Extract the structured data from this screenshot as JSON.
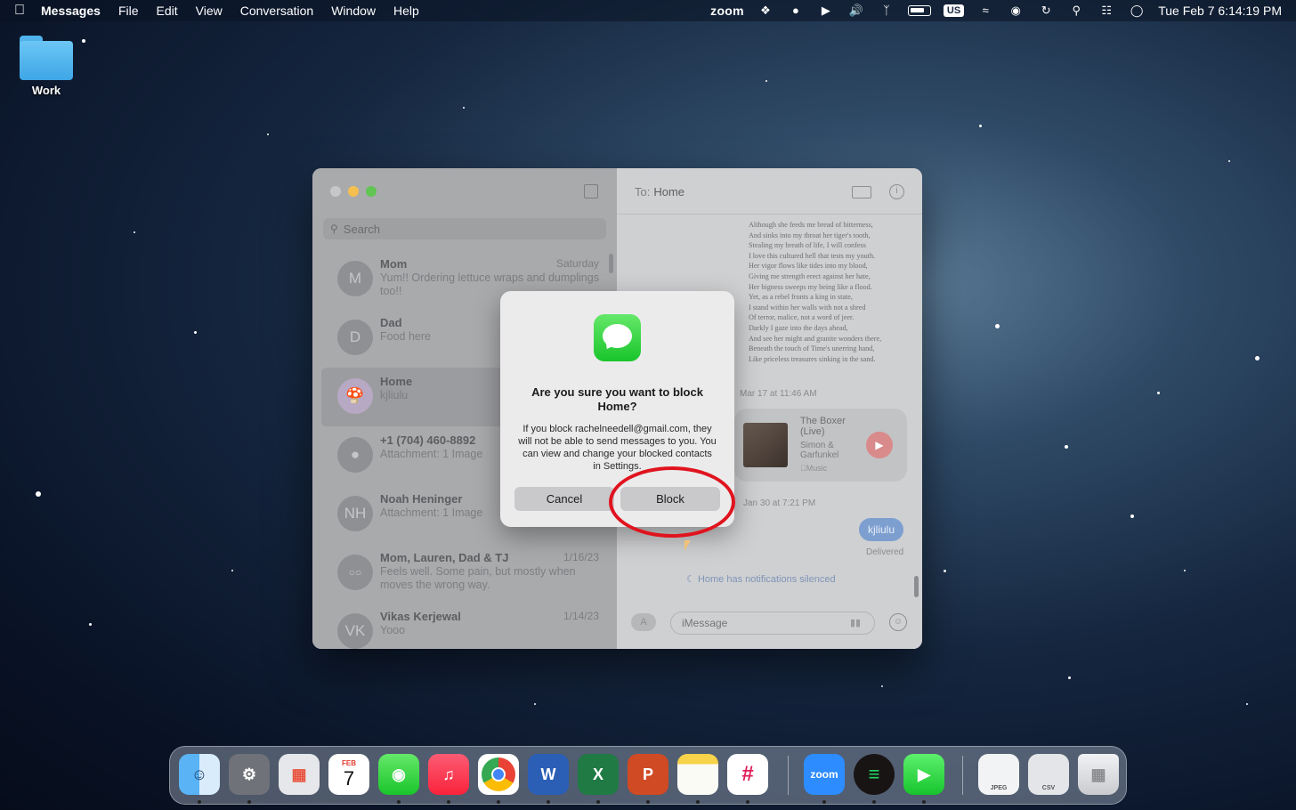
{
  "menubar": {
    "app_name": "Messages",
    "menus": [
      "File",
      "Edit",
      "View",
      "Conversation",
      "Window",
      "Help"
    ],
    "zoom_label": "zoom",
    "input_source": "US",
    "datetime": "Tue Feb 7  6:14:19 PM"
  },
  "desktop": {
    "folder_label": "Work"
  },
  "messages": {
    "search_placeholder": "Search",
    "conversations": [
      {
        "initials": "M",
        "name": "Mom",
        "preview": "Yum!! Ordering lettuce wraps and dumplings too!!",
        "time": "Saturday"
      },
      {
        "initials": "D",
        "name": "Dad",
        "preview": "Food here",
        "time": ""
      },
      {
        "initials": "",
        "name": "Home",
        "preview": "kjliulu",
        "time": "",
        "selected": true
      },
      {
        "initials": "",
        "name": "+1 (704) 460-8892",
        "preview": "Attachment: 1 Image",
        "time": ""
      },
      {
        "initials": "NH",
        "name": "Noah Heninger",
        "preview": "Attachment: 1 Image",
        "time": ""
      },
      {
        "initials": "",
        "name": "Mom, Lauren, Dad & TJ",
        "preview": "Feels well.  Some pain,  but mostly when moves the wrong way.",
        "time": "1/16/23"
      },
      {
        "initials": "VK",
        "name": "Vikas Kerjewal",
        "preview": "Yooo",
        "time": "1/14/23"
      }
    ],
    "chat": {
      "to_label": "To:",
      "to_name": "Home",
      "poem_lines": [
        "Although she feeds me bread of bitterness,",
        "And sinks into my throat her tiger's tooth,",
        "Stealing my breath of life, I will confess",
        "I love this cultured hell that tests my youth.",
        "Her vigor flows like tides into my blood,",
        "Giving me strength erect against her hate,",
        "Her bigness sweeps my being like a flood.",
        "Yet, as a rebel fronts a king in state,",
        "I stand within her walls with not a shred",
        "Of terror, malice, not a word of jeer.",
        "Darkly I gaze into the days ahead,",
        "And see her might and granite wonders there,",
        "Beneath the touch of Time's unerring hand,",
        "Like priceless treasures sinking in the sand."
      ],
      "timestamp_1": "Mar 17 at 11:46 AM",
      "music_title": "The Boxer (Live)",
      "music_artist": "Simon & Garfunkel",
      "music_source": "Music",
      "timestamp_2": "Jan 30 at 7:21 PM",
      "sent_bubble": "kjliulu",
      "delivered": "Delivered",
      "silenced_note": "Home has notifications silenced",
      "input_placeholder": "iMessage"
    }
  },
  "dialog": {
    "title": "Are you sure you want to block Home?",
    "message": "If you block rachelneedell@gmail.com, they will not be able to send messages to you. You can view and change your blocked contacts in Settings.",
    "cancel_label": "Cancel",
    "block_label": "Block"
  },
  "dock": {
    "calendar_month": "FEB",
    "calendar_day": "7",
    "zoom_label": "zoom",
    "word_letter": "W",
    "excel_letter": "X",
    "ppt_letter": "P",
    "jpeg_label": "JPEG",
    "csv_label": "CSV"
  },
  "colors": {
    "close": "#c6c7c9",
    "minimize": "#f5bf4f",
    "zoom": "#61c554",
    "highlight_circle": "#e0141e"
  }
}
